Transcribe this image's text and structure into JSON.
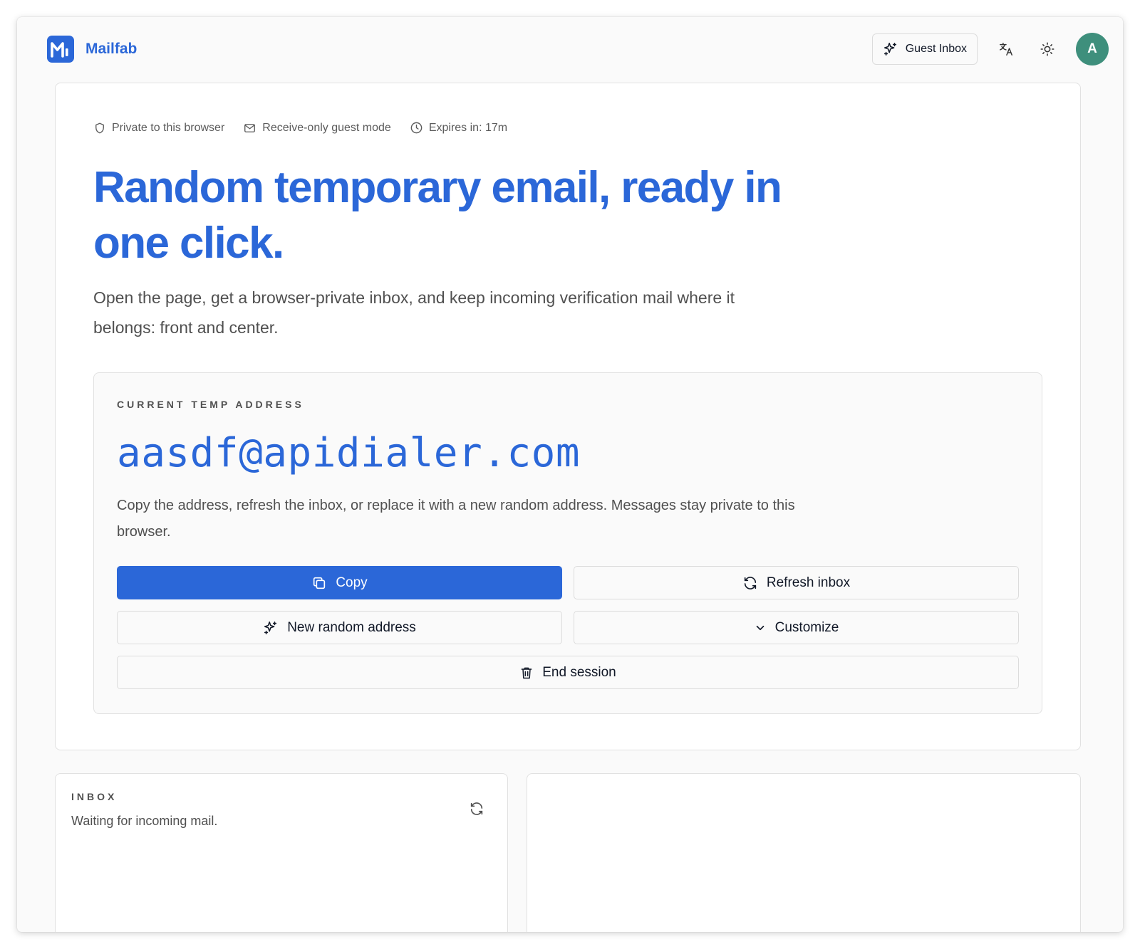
{
  "header": {
    "brand_name": "Mailfab",
    "guest_inbox_label": "Guest Inbox",
    "translate_icon": "translate-icon",
    "theme_icon": "sun-icon",
    "avatar_initial": "A"
  },
  "hero": {
    "meta": {
      "private": "Private to this browser",
      "mode": "Receive-only guest mode",
      "expires": "Expires in: 17m"
    },
    "title": "Random temporary email, ready in one click.",
    "subtitle": "Open the page, get a browser-private inbox, and keep incoming verification mail where it belongs: front and center."
  },
  "address_card": {
    "label": "CURRENT TEMP ADDRESS",
    "address": "aasdf@apidialer.com",
    "description": "Copy the address, refresh the inbox, or replace it with a new random address. Messages stay private to this browser.",
    "buttons": {
      "copy": "Copy",
      "refresh": "Refresh inbox",
      "new_random": "New random address",
      "customize": "Customize",
      "end_session": "End session"
    }
  },
  "inbox": {
    "label": "INBOX",
    "status": "Waiting for incoming mail."
  },
  "colors": {
    "accent": "#2b67d8",
    "avatar": "#3e8f7c",
    "background": "#fafafa"
  }
}
